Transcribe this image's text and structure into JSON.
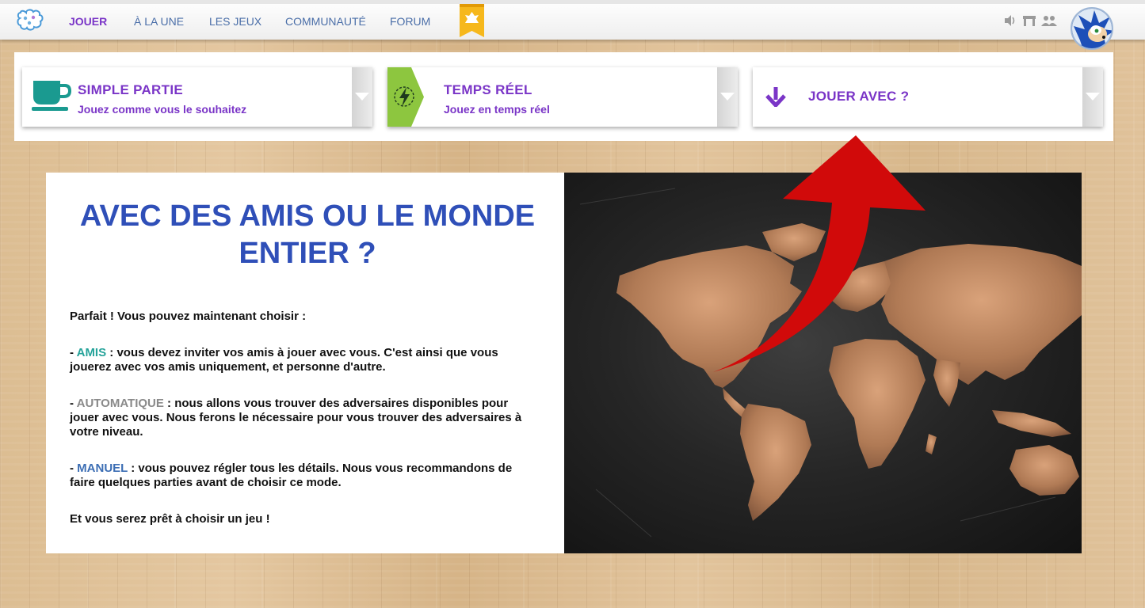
{
  "nav": {
    "items": [
      {
        "label": "JOUER",
        "active": true
      },
      {
        "label": "À LA UNE",
        "active": false
      },
      {
        "label": "LES JEUX",
        "active": false
      },
      {
        "label": "COMMUNAUTÉ",
        "active": false
      },
      {
        "label": "FORUM",
        "active": false
      }
    ],
    "icons": [
      "sound-icon",
      "table-icon",
      "group-icon"
    ],
    "colors": {
      "active": "#7a35c7",
      "link": "#4a6ea8"
    }
  },
  "wizard": {
    "steps": [
      {
        "title": "SIMPLE PARTIE",
        "subtitle": "Jouez comme vous le souhaitez",
        "icon": "cup-icon"
      },
      {
        "title": "TEMPS RÉEL",
        "subtitle": "Jouez en temps réel",
        "icon": "lightning-icon"
      },
      {
        "title": "JOUER AVEC ?",
        "subtitle": "",
        "icon": "arrow-down-icon"
      }
    ],
    "accent": "#7a35c7"
  },
  "info": {
    "title": "AVEC DES AMIS OU LE MONDE ENTIER ?",
    "intro": "Parfait ! Vous pouvez maintenant choisir :",
    "options": [
      {
        "prefix": "- ",
        "keyword": "AMIS",
        "text": " : vous devez inviter vos amis à jouer avec vous. C'est ainsi que vous jouerez avec vos amis uniquement, et personne d'autre."
      },
      {
        "prefix": "- ",
        "keyword": "AUTOMATIQUE",
        "text": " : nous allons vous trouver des adversaires disponibles pour jouer avec vous. Nous ferons le nécessaire pour vous trouver des adversaires à votre niveau."
      },
      {
        "prefix": "- ",
        "keyword": "MANUEL",
        "text": " : vous pouvez régler tous les détails. Nous vous recommandons de faire quelques parties avant de choisir ce mode."
      }
    ],
    "outro": "Et vous serez prêt à choisir un jeu !",
    "colors": {
      "title": "#2f4fb8",
      "amis": "#26a39a",
      "automatique": "#8a8a8a",
      "manuel": "#3c6eb4"
    }
  }
}
